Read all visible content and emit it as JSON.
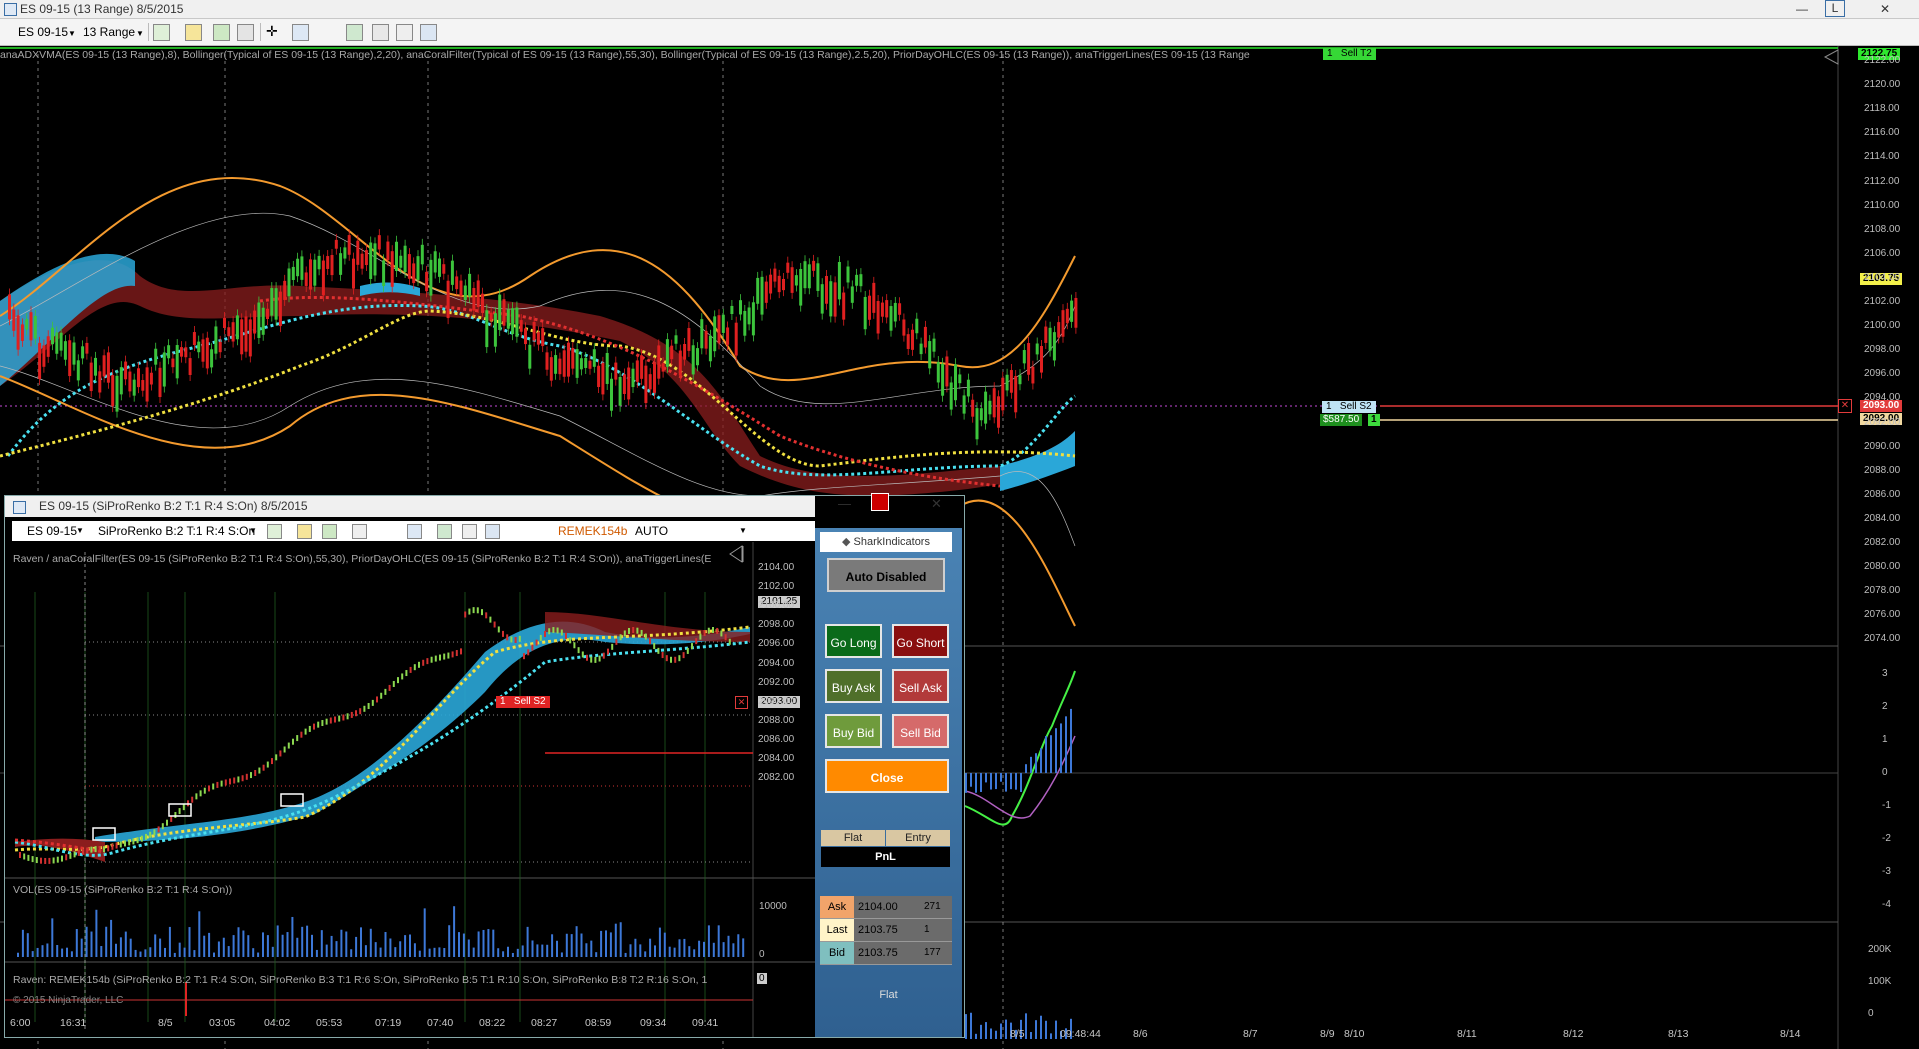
{
  "window": {
    "title": "ES 09-15 (13 Range)  8/5/2015",
    "minimize": "—",
    "restore": "L",
    "close": "✕"
  },
  "toolbar": {
    "instrument": "ES 09-15",
    "period": "13 Range"
  },
  "main": {
    "indicators_label": "anaADXVMA(ES 09-15 (13 Range),8), Bollinger(Typical of ES 09-15 (13 Range),2,20), anaCoralFilter(Typical of ES 09-15 (13 Range),55,30), Bollinger(Typical of ES 09-15 (13 Range),2.5,20), PriorDayOHLC(ES 09-15 (13 Range)), anaTriggerLines(ES 09-15 (13 Range",
    "price_axis": [
      "2122.00",
      "2120.00",
      "2118.00",
      "2116.00",
      "2114.00",
      "2112.00",
      "2110.00",
      "2108.00",
      "2106.00",
      "2104.00",
      "2102.00",
      "2100.00",
      "2098.00",
      "2096.00",
      "2094.00",
      "2092.00",
      "2090.00",
      "2088.00",
      "2086.00",
      "2084.00",
      "2082.00",
      "2080.00",
      "2078.00",
      "2076.00",
      "2074.00"
    ],
    "osc_axis": [
      "3",
      "2",
      "1",
      "0",
      "-1",
      "-2",
      "-3",
      "-4"
    ],
    "vol_axis": [
      "200K",
      "100K",
      "0"
    ],
    "time_axis": [
      "8/5",
      "09:48:44",
      "8/6",
      "8/7",
      "8/9",
      "8/10",
      "8/11",
      "8/12",
      "8/13",
      "8/14"
    ],
    "last_price": "2103.75",
    "top_price": "2122.75",
    "sell_t2": {
      "qty": "1",
      "label": "Sell T2"
    },
    "sell_s2": {
      "qty": "1",
      "label": "Sell S2",
      "price": "2093.00"
    },
    "position": {
      "pnl": "$587.50",
      "qty": "1",
      "price": "2092.00"
    }
  },
  "sub": {
    "title": "ES 09-15 (SiProRenko B:2 T:1 R:4 S:On)  8/5/2015",
    "instrument": "ES 09-15",
    "period": "SiProRenko B:2 T:1 R:4 S:On",
    "account": "REMEK154b",
    "mode": "AUTO",
    "indicators_label": "Raven / anaCoralFilter(ES 09-15 (SiProRenko B:2 T:1 R:4 S:On),55,30), PriorDayOHLC(ES 09-15 (SiProRenko B:2 T:1 R:4 S:On)), anaTriggerLines(E",
    "price_axis": [
      "2104.00",
      "2102.00",
      "2100.00",
      "2098.00",
      "2096.00",
      "2094.00",
      "2092.00",
      "2090.00",
      "2088.00",
      "2086.00",
      "2084.00",
      "2082.00"
    ],
    "last_price": "2101.25",
    "sell_s2": {
      "qty": "1",
      "label": "Sell S2",
      "price": "2093.00"
    },
    "vol_label": "VOL(ES 09-15 (SiProRenko B:2 T:1 R:4 S:On))",
    "vol_axis": [
      "10000",
      "0"
    ],
    "raven_label": "Raven: REMEK154b (SiProRenko B:2 T:1 R:4 S:On, SiProRenko B:3 T:1 R:6 S:On, SiProRenko B:5 T:1 R:10 S:On, SiProRenko B:8 T:2 R:16 S:On, 1",
    "raven_value": "0",
    "copyright": "© 2015 NinjaTrader, LLC",
    "time_axis": [
      "6:00",
      "16:31",
      "8/5",
      "03:05",
      "04:02",
      "05:53",
      "07:19",
      "07:40",
      "08:22",
      "08:27",
      "08:59",
      "09:34",
      "09:41"
    ]
  },
  "panel": {
    "brand": "SharkIndicators",
    "auto": "Auto Disabled",
    "go_long": "Go Long",
    "go_short": "Go Short",
    "buy_ask": "Buy Ask",
    "sell_ask": "Sell Ask",
    "buy_bid": "Buy Bid",
    "sell_bid": "Sell Bid",
    "close": "Close",
    "flat": "Flat",
    "entry": "Entry",
    "pnl": "PnL",
    "quotes": [
      {
        "label": "Ask",
        "price": "2104.00",
        "size": "271",
        "color": "#f1a46a"
      },
      {
        "label": "Last",
        "price": "2103.75",
        "size": "1",
        "color": "#fff4c8"
      },
      {
        "label": "Bid",
        "price": "2103.75",
        "size": "177",
        "color": "#7fbfbf"
      }
    ],
    "status": "Flat"
  },
  "colors": {
    "bull": "#3cc43c",
    "bear": "#e02020",
    "coral": "#2aa7d8",
    "band": "#f39a2e"
  }
}
